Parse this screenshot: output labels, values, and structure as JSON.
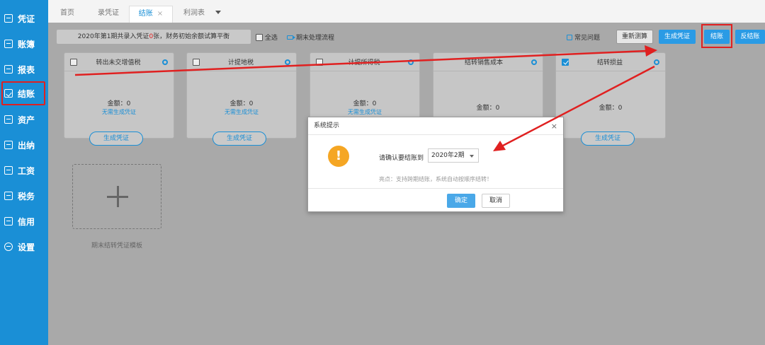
{
  "sidebar": {
    "items": [
      {
        "label": "凭证"
      },
      {
        "label": "账簿"
      },
      {
        "label": "报表"
      },
      {
        "label": "结账"
      },
      {
        "label": "资产"
      },
      {
        "label": "出纳"
      },
      {
        "label": "工资"
      },
      {
        "label": "税务"
      },
      {
        "label": "信用"
      },
      {
        "label": "设置"
      }
    ],
    "active_index": 3
  },
  "tabs": [
    {
      "label": "首页"
    },
    {
      "label": "录凭证"
    },
    {
      "label": "结账",
      "close": "×"
    },
    {
      "label": "利润表"
    }
  ],
  "toolbar": {
    "notice_prefix": "2020年第1期共录入凭证",
    "notice_count": "0",
    "notice_suffix": "张，财务初始余额试算平衡",
    "select_all": "全选",
    "period_flow": "期末处理流程",
    "faq": "常见问题",
    "recalc": "重新测算",
    "generate_voucher": "生成凭证",
    "close_account": "结账",
    "reverse_close": "反结账"
  },
  "cards": [
    {
      "title": "转出未交增值税",
      "amount": "金额：0",
      "no_need": "无需生成凭证",
      "button": "生成凭证",
      "checked": false
    },
    {
      "title": "计提地税",
      "amount": "金额：0",
      "no_need": "无需生成凭证",
      "button": "生成凭证",
      "checked": false
    },
    {
      "title": "计提所得税",
      "amount": "金额：0",
      "no_need": "无需生成凭证",
      "checked": false
    },
    {
      "title": "结转销售成本",
      "amount": "金额：0",
      "checked": false
    },
    {
      "title": "结转损益",
      "amount": "金额：0",
      "button": "生成凭证",
      "checked": true
    }
  ],
  "template": {
    "label": "期末结转凭证模板"
  },
  "dialog": {
    "title": "系统提示",
    "close": "×",
    "icon": "!",
    "confirm_label": "请确认要结账到",
    "period": "2020年2期",
    "tip": "亮点：支持跨期结账，系统自动按顺序结转！",
    "ok": "确定",
    "cancel": "取消"
  },
  "colors": {
    "primary": "#1a8fd6",
    "warning": "#f5a623",
    "annotation": "#e02020"
  }
}
